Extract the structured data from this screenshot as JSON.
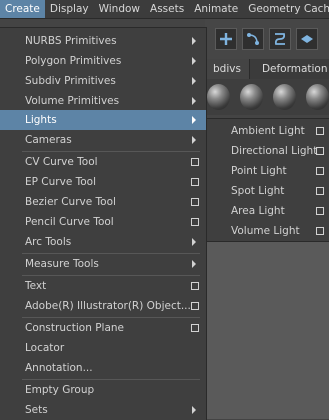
{
  "menubar": {
    "items": [
      "Create",
      "Display",
      "Window",
      "Assets",
      "Animate",
      "Geometry Cach"
    ]
  },
  "shelf": {
    "tabs": [
      "bdivs",
      "Deformation"
    ],
    "icons": [
      "plus-shelf-icon",
      "curve-shelf-icon",
      "spiral-shelf-icon",
      "cube-shelf-icon"
    ]
  },
  "create_menu": {
    "items": [
      {
        "label": "NURBS Primitives",
        "type": "submenu"
      },
      {
        "label": "Polygon Primitives",
        "type": "submenu"
      },
      {
        "label": "Subdiv Primitives",
        "type": "submenu"
      },
      {
        "label": "Volume Primitives",
        "type": "submenu"
      },
      {
        "label": "Lights",
        "type": "submenu",
        "highlighted": true
      },
      {
        "label": "Cameras",
        "type": "submenu"
      },
      {
        "label": "CV Curve Tool",
        "type": "option"
      },
      {
        "label": "EP Curve Tool",
        "type": "option"
      },
      {
        "label": "Bezier Curve Tool",
        "type": "option"
      },
      {
        "label": "Pencil Curve Tool",
        "type": "option"
      },
      {
        "label": "Arc Tools",
        "type": "submenu"
      },
      {
        "label": "Measure Tools",
        "type": "submenu"
      },
      {
        "label": "Text",
        "type": "option"
      },
      {
        "label": "Adobe(R) Illustrator(R) Object...",
        "type": "option"
      },
      {
        "label": "Construction Plane",
        "type": "option"
      },
      {
        "label": "Locator",
        "type": "plain"
      },
      {
        "label": "Annotation...",
        "type": "plain"
      },
      {
        "label": "Empty Group",
        "type": "plain"
      },
      {
        "label": "Sets",
        "type": "submenu"
      }
    ]
  },
  "lights_submenu": {
    "items": [
      "Ambient Light",
      "Directional Light",
      "Point Light",
      "Spot Light",
      "Area Light",
      "Volume Light"
    ]
  },
  "colors": {
    "highlight": "#5d84a6",
    "menu_bg": "#3f3f3f",
    "text": "#d2d2d2"
  }
}
